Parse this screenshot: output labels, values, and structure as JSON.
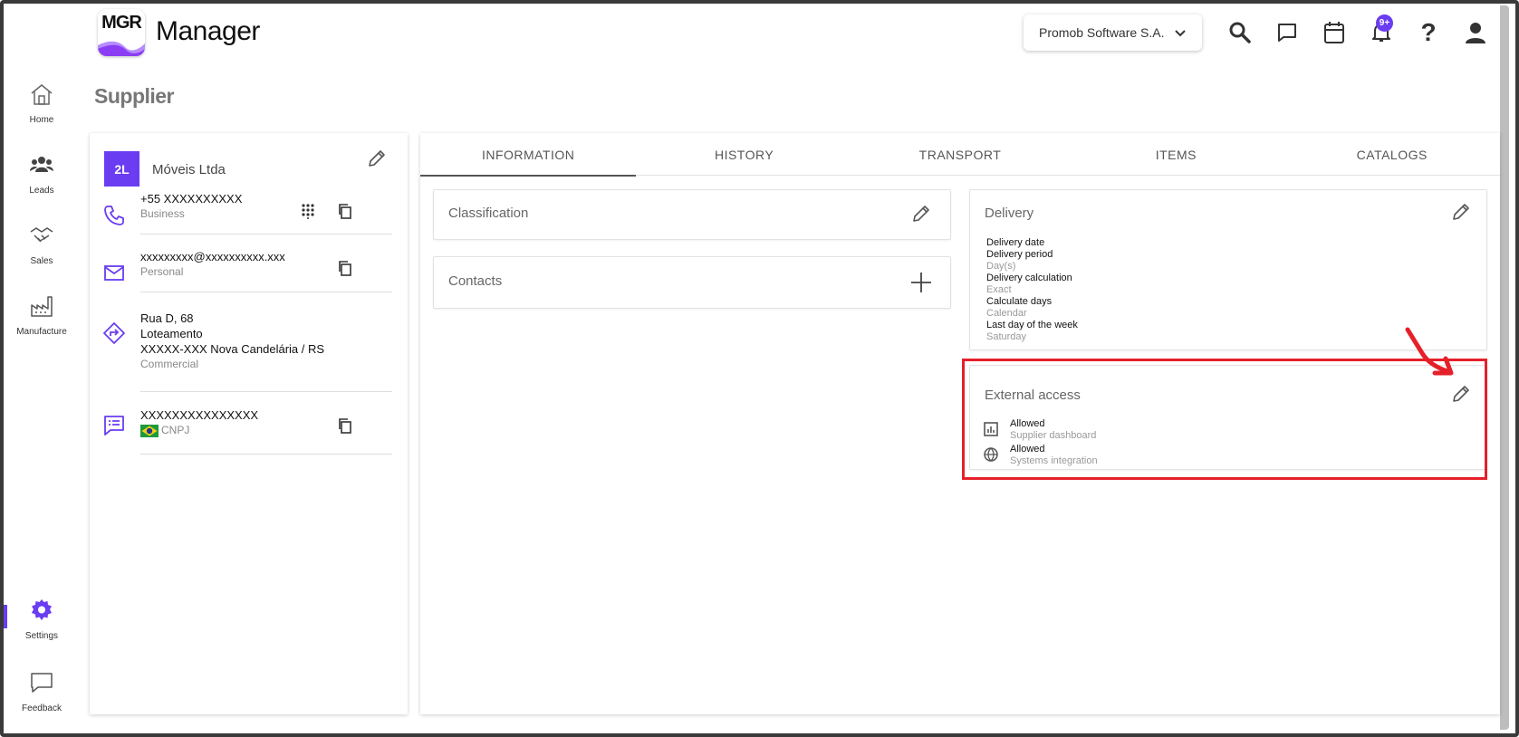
{
  "app": {
    "logo_text": "MGR",
    "title": "Manager",
    "company": "Promob Software S.A.",
    "notifications_badge": "9+",
    "accent_color": "#6a3df2"
  },
  "nav": {
    "items": [
      {
        "label": "Home",
        "icon": "home-icon"
      },
      {
        "label": "Leads",
        "icon": "leads-icon"
      },
      {
        "label": "Sales",
        "icon": "handshake-icon"
      },
      {
        "label": "Manufacture",
        "icon": "factory-icon"
      }
    ],
    "bottom": [
      {
        "label": "Settings",
        "icon": "gear-icon"
      },
      {
        "label": "Feedback",
        "icon": "feedback-icon"
      }
    ]
  },
  "page": {
    "title": "Supplier"
  },
  "supplier": {
    "initials": "2L",
    "name": "Móveis Ltda",
    "phone": {
      "value": "+55 XXXXXXXXXX",
      "type": "Business"
    },
    "email": {
      "value": "xxxxxxxxx@xxxxxxxxxx.xxx",
      "type": "Personal"
    },
    "address": {
      "line1": "Rua D, 68",
      "line2": "Loteamento",
      "line3": "XXXXX-XXX Nova Candelária / RS",
      "type": "Commercial"
    },
    "document": {
      "value": "XXXXXXXXXXXXXXX",
      "type": "CNPJ"
    }
  },
  "tabs": [
    "INFORMATION",
    "HISTORY",
    "TRANSPORT",
    "ITEMS",
    "CATALOGS"
  ],
  "information": {
    "classification_title": "Classification",
    "contacts_title": "Contacts",
    "delivery": {
      "title": "Delivery",
      "fields": [
        {
          "label": "Delivery date",
          "value": ""
        },
        {
          "label": "Delivery period",
          "value": "Day(s)"
        },
        {
          "label": "Delivery calculation",
          "value": "Exact"
        },
        {
          "label": "Calculate days",
          "value": "Calendar"
        },
        {
          "label": "Last day of the week",
          "value": "Saturday"
        }
      ]
    },
    "external_access": {
      "title": "External access",
      "items": [
        {
          "status": "Allowed",
          "label": "Supplier dashboard",
          "icon": "bar-chart-icon"
        },
        {
          "status": "Allowed",
          "label": "Systems integration",
          "icon": "globe-icon"
        }
      ]
    }
  }
}
